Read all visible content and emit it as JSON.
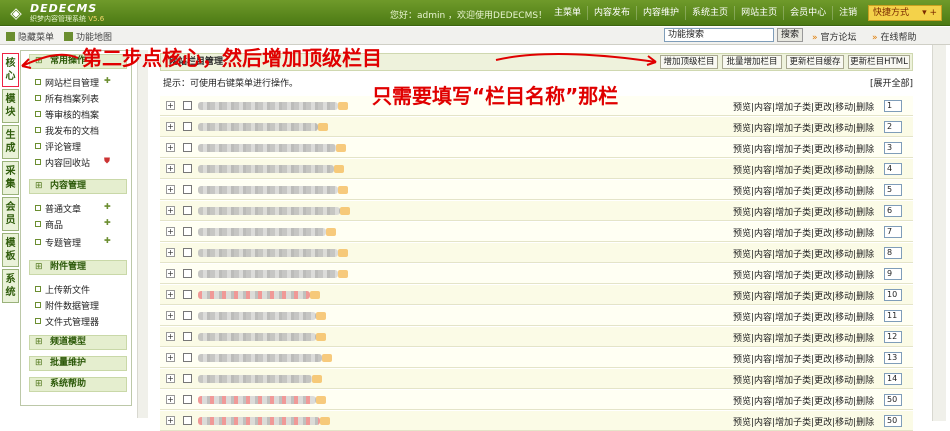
{
  "app": {
    "logo_text": "DEDECMS",
    "logo_subtitle": "织梦内容管理系统",
    "version": "V5.6",
    "greeting": "您好：admin ，欢迎使用DEDECMS！",
    "nav": [
      "主菜单",
      "内容发布",
      "内容维护",
      "系统主页",
      "网站主页",
      "会员中心",
      "注销"
    ],
    "quick_menu": "快捷方式"
  },
  "subbar": {
    "hide_menu": "隐藏菜单",
    "site_map": "功能地图",
    "search_value": "功能搜索",
    "search_button": "搜索",
    "forum": "官方论坛",
    "help": "在线帮助"
  },
  "vtabs": [
    "核心",
    "模块",
    "生成",
    "采集",
    "会员",
    "模板",
    "系统"
  ],
  "sidebar": {
    "sec1": "常用操作",
    "sec1_items": [
      "网站栏目管理",
      "所有档案列表",
      "等审核的档案",
      "我发布的文档",
      "评论管理",
      "内容回收站"
    ],
    "sec2": "内容管理",
    "sec2_items": [
      "普通文章",
      "商品",
      "专题管理"
    ],
    "sec3": "附件管理",
    "sec3_items": [
      "上传新文件",
      "附件数据管理",
      "文件式管理器"
    ],
    "sec4": "频道模型",
    "sec5": "批量维护",
    "sec6": "系统帮助"
  },
  "content": {
    "title": "网站栏目管理",
    "buttons": [
      "增加顶级栏目",
      "批量增加栏目",
      "更新栏目缓存",
      "更新栏目HTML"
    ],
    "hint": "提示：可使用右键菜单进行操作。",
    "expand_all": "[展开全部]",
    "action_links": "预览|内容|增加子类|更改|移动|删除",
    "orders": [
      "1",
      "2",
      "3",
      "4",
      "5",
      "6",
      "7",
      "8",
      "9",
      "10",
      "11",
      "12",
      "13",
      "14",
      "50",
      "50"
    ]
  },
  "annotations": {
    "step2": "第二步点核心，然后增加顶级栏目",
    "fill_note": "只需要填写“栏目名称”那栏"
  },
  "colors": {
    "topbar": "#5a8a1c",
    "annotation": "#e00000",
    "quick_menu": "#f4d24a"
  }
}
